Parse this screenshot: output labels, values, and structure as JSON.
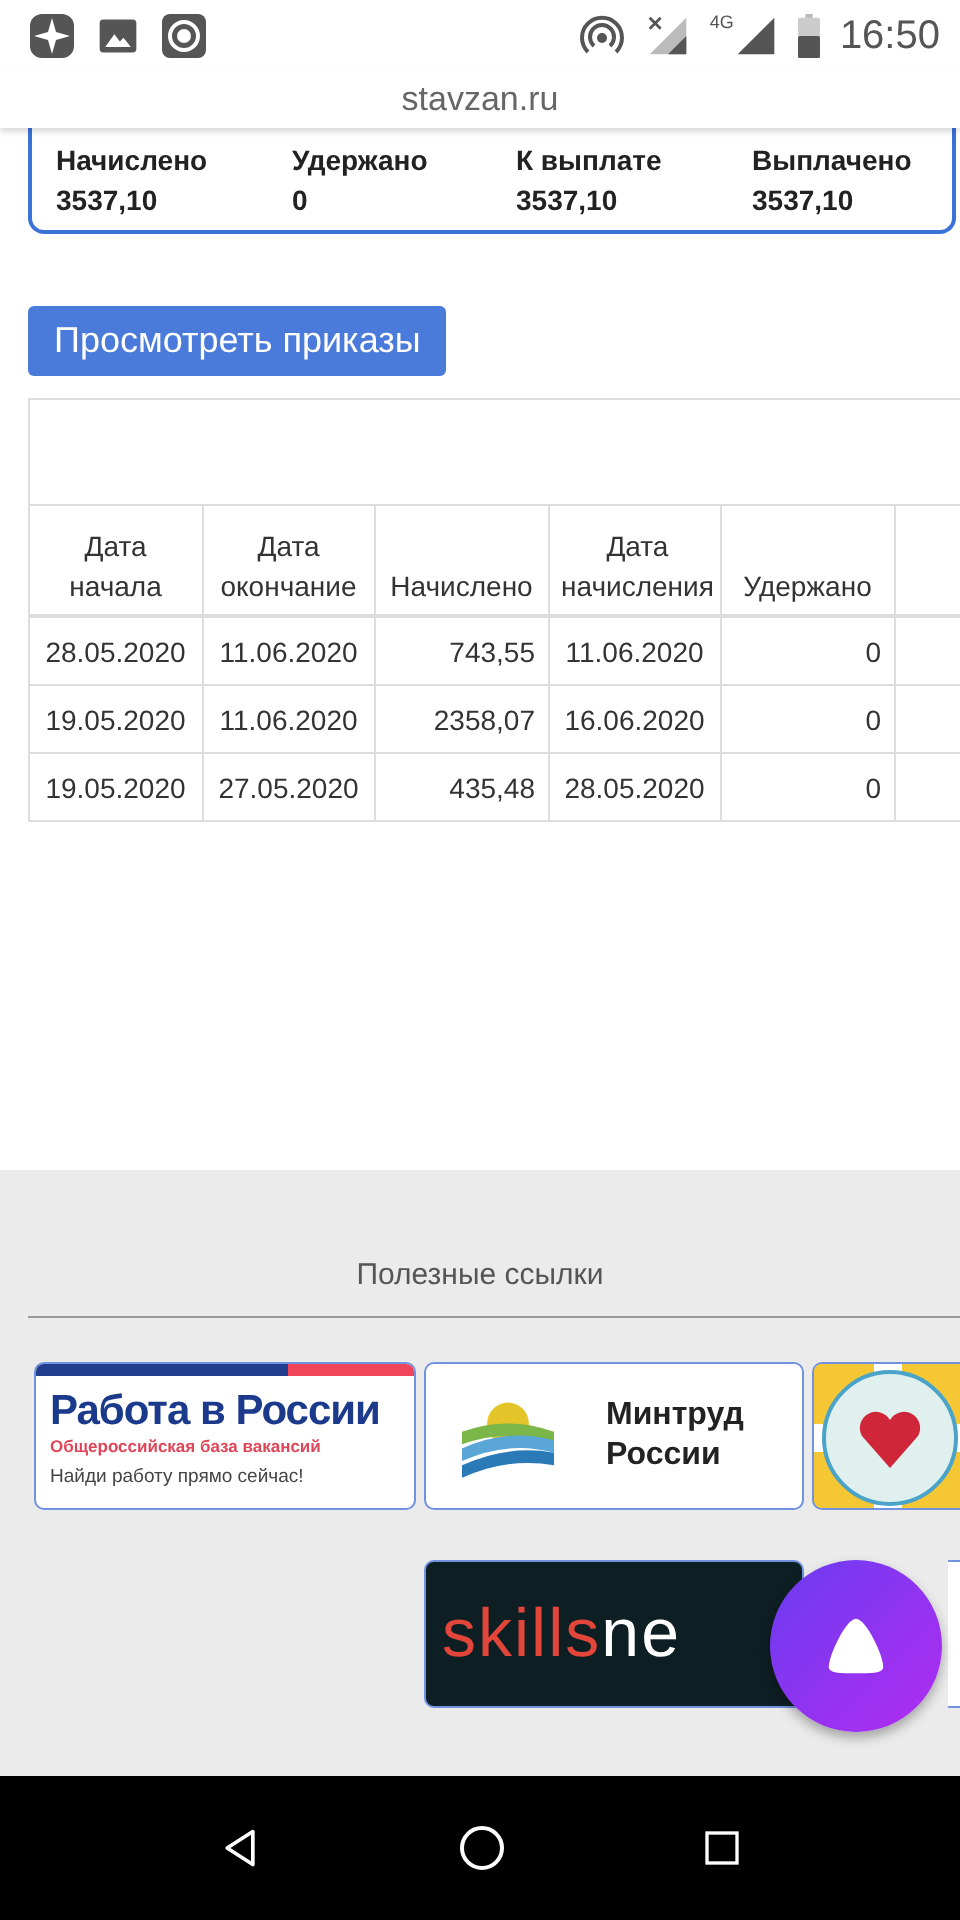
{
  "status_bar": {
    "time": "16:50",
    "network": "4G"
  },
  "address_bar": {
    "url": "stavzan.ru"
  },
  "summary": [
    {
      "label": "Начислено",
      "value": "3537,10"
    },
    {
      "label": "Удержано",
      "value": "0"
    },
    {
      "label": "К выплате",
      "value": "3537,10"
    },
    {
      "label": "Выплачено",
      "value": "3537,10"
    }
  ],
  "orders_button": "Просмотреть приказы",
  "table": {
    "columns": [
      "Дата начала",
      "Дата окончание",
      "Начислено",
      "Дата начисления",
      "Удержано"
    ],
    "rows": [
      [
        "28.05.2020",
        "11.06.2020",
        "743,55",
        "11.06.2020",
        "0"
      ],
      [
        "19.05.2020",
        "11.06.2020",
        "2358,07",
        "16.06.2020",
        "0"
      ],
      [
        "19.05.2020",
        "27.05.2020",
        "435,48",
        "28.05.2020",
        "0"
      ]
    ]
  },
  "footer": {
    "title": "Полезные ссылки",
    "banners": [
      {
        "kind": "rabota",
        "title": "Работа в России",
        "subtitle": "Общероссийская база вакансий",
        "tagline": "Найди работу прямо сейчас!"
      },
      {
        "kind": "mintrud",
        "title": "Минтруд России"
      },
      {
        "kind": "heart"
      },
      {
        "kind": "skillsnet",
        "part_1": "skills",
        "part_2": "ne"
      },
      {
        "kind": "emblem"
      }
    ]
  }
}
